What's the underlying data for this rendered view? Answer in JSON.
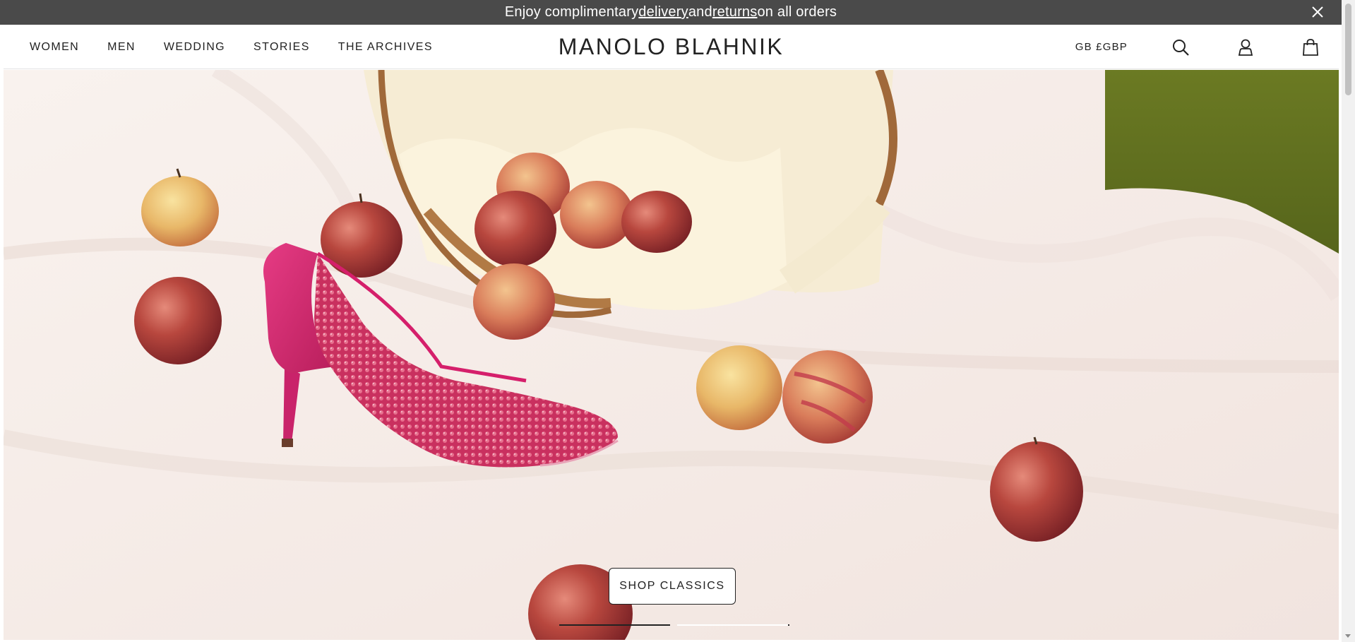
{
  "announcement": {
    "prefix": "Enjoy complimentary ",
    "delivery_link": "delivery",
    "middle": " and ",
    "returns_link": "returns",
    "suffix": " on all orders"
  },
  "nav": {
    "items": [
      "WOMEN",
      "MEN",
      "WEDDING",
      "STORIES",
      "THE ARCHIVES"
    ]
  },
  "brand": {
    "logo_text": "MANOLO BLAHNIK"
  },
  "header_tools": {
    "currency": "GB £GBP",
    "icons": [
      "search-icon",
      "account-icon",
      "bag-icon"
    ]
  },
  "hero": {
    "cta_label": "SHOP CLASSICS",
    "slides_count": 2,
    "active_slide": 1
  },
  "colors": {
    "announcement_bg": "#4a4a4a",
    "text": "#222222",
    "hero_bg": "#f6ebe6",
    "shoe": "#d8286f",
    "apple_red": "#b03a3a"
  }
}
